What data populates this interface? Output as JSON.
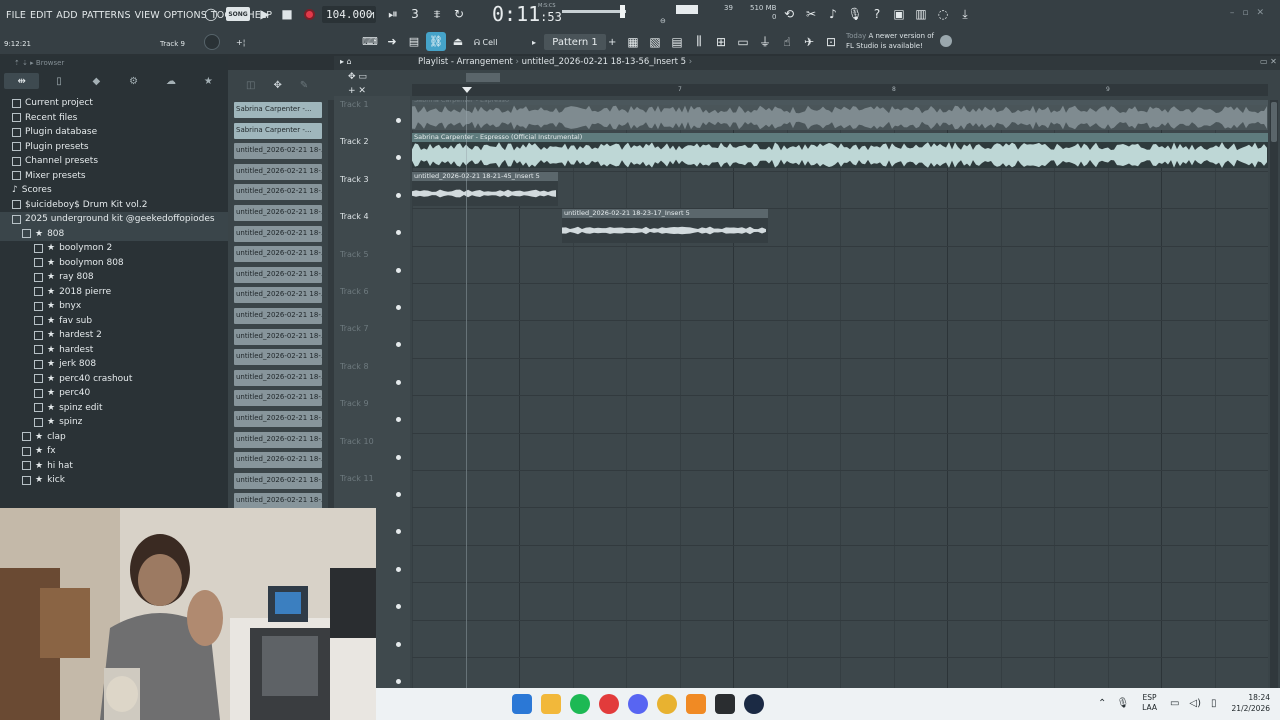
{
  "menu": [
    "FILE",
    "EDIT",
    "ADD",
    "PATTERNS",
    "VIEW",
    "OPTIONS",
    "TOOLS",
    "HELP"
  ],
  "transport": {
    "mode_label": "SONG",
    "tempo": "104.000",
    "time_main": "0:11",
    "time_sub": ":53",
    "time_unit": "M:S:CS",
    "volume_level": "39",
    "memory": "510 MB",
    "voices": "0"
  },
  "toolbar2": {
    "cursor_time": "9:12:21",
    "track_hint": "Track 9",
    "snap_mode": "Cell",
    "pattern": "Pattern 1",
    "news_date": "Today",
    "news_text_1": "A newer version of",
    "news_text_2": "FL Studio is available!"
  },
  "browser": {
    "header": "Browser",
    "items": [
      {
        "label": "Current project",
        "level": 0,
        "kind": "folder"
      },
      {
        "label": "Recent files",
        "level": 0,
        "kind": "folder"
      },
      {
        "label": "Plugin database",
        "level": 0,
        "kind": "folder"
      },
      {
        "label": "Plugin presets",
        "level": 0,
        "kind": "folder"
      },
      {
        "label": "Channel presets",
        "level": 0,
        "kind": "folder"
      },
      {
        "label": "Mixer presets",
        "level": 0,
        "kind": "folder"
      },
      {
        "label": "Scores",
        "level": 0,
        "kind": "note"
      },
      {
        "label": "$uicideboy$ Drum Kit vol.2",
        "level": 0,
        "kind": "folder"
      },
      {
        "label": "2025 underground kit @geekedoffopiodes",
        "level": 0,
        "kind": "folder-open"
      },
      {
        "label": "808",
        "level": 1,
        "kind": "star-folder"
      },
      {
        "label": "boolymon 2",
        "level": 2,
        "kind": "star-file"
      },
      {
        "label": "boolymon 808",
        "level": 2,
        "kind": "star-file"
      },
      {
        "label": "ray 808",
        "level": 2,
        "kind": "star-file"
      },
      {
        "label": "2018 pierre",
        "level": 2,
        "kind": "star-file"
      },
      {
        "label": "bnyx",
        "level": 2,
        "kind": "star-file"
      },
      {
        "label": "fav sub",
        "level": 2,
        "kind": "star-file"
      },
      {
        "label": "hardest 2",
        "level": 2,
        "kind": "star-file"
      },
      {
        "label": "hardest",
        "level": 2,
        "kind": "star-file"
      },
      {
        "label": "jerk 808",
        "level": 2,
        "kind": "star-file"
      },
      {
        "label": "perc40 crashout",
        "level": 2,
        "kind": "star-file"
      },
      {
        "label": "perc40",
        "level": 2,
        "kind": "star-file"
      },
      {
        "label": "spinz edit",
        "level": 2,
        "kind": "star-file"
      },
      {
        "label": "spinz",
        "level": 2,
        "kind": "star-file"
      },
      {
        "label": "clap",
        "level": 1,
        "kind": "star-folder"
      },
      {
        "label": "fx",
        "level": 1,
        "kind": "star-folder"
      },
      {
        "label": "hi hat",
        "level": 1,
        "kind": "star-folder"
      },
      {
        "label": "kick",
        "level": 1,
        "kind": "star-folder"
      }
    ]
  },
  "channels": [
    {
      "label": "Sabrina Carpenter -...",
      "audio": true
    },
    {
      "label": "Sabrina Carpenter -...",
      "audio": true
    },
    {
      "label": "untitled_2026-02-21 18-...",
      "audio": false
    },
    {
      "label": "untitled_2026-02-21 18-...",
      "audio": false
    },
    {
      "label": "untitled_2026-02-21 18-...",
      "audio": false
    },
    {
      "label": "untitled_2026-02-21 18-...",
      "audio": false
    },
    {
      "label": "untitled_2026-02-21 18-...",
      "audio": false
    },
    {
      "label": "untitled_2026-02-21 18-...",
      "audio": false
    },
    {
      "label": "untitled_2026-02-21 18-...",
      "audio": false
    },
    {
      "label": "untitled_2026-02-21 18-...",
      "audio": false
    },
    {
      "label": "untitled_2026-02-21 18-...",
      "audio": false
    },
    {
      "label": "untitled_2026-02-21 18-...",
      "audio": false
    },
    {
      "label": "untitled_2026-02-21 18-...",
      "audio": false
    },
    {
      "label": "untitled_2026-02-21 18-...",
      "audio": false
    },
    {
      "label": "untitled_2026-02-21 18-...",
      "audio": false
    },
    {
      "label": "untitled_2026-02-21 18-...",
      "audio": false
    },
    {
      "label": "untitled_2026-02-21 18-...",
      "audio": false
    },
    {
      "label": "untitled_2026-02-21 18-...",
      "audio": false
    },
    {
      "label": "untitled_2026-02-21 18-...",
      "audio": false
    },
    {
      "label": "untitled_2026-02-21 18-...",
      "audio": false
    }
  ],
  "playlist": {
    "title": "Playlist - Arrangement",
    "arrangement": "untitled_2026-02-21 18-13-56_Insert 5",
    "bar_numbers": [
      "7",
      "8",
      "9"
    ],
    "tracks": [
      {
        "label": "Track 1",
        "active": false
      },
      {
        "label": "Track 2",
        "active": true
      },
      {
        "label": "Track 3",
        "active": true
      },
      {
        "label": "Track 4",
        "active": true
      },
      {
        "label": "Track 5",
        "active": false
      },
      {
        "label": "Track 6",
        "active": false
      },
      {
        "label": "Track 7",
        "active": false
      },
      {
        "label": "Track 8",
        "active": false
      },
      {
        "label": "Track 9",
        "active": false
      },
      {
        "label": "Track 10",
        "active": false
      },
      {
        "label": "Track 11",
        "active": false
      }
    ],
    "clips": [
      {
        "track": 1,
        "title": "Sabrina Carpenter - Espresso"
      },
      {
        "track": 2,
        "title": "Sabrina Carpenter - Espresso (Official Instrumental)"
      },
      {
        "track": 3,
        "title": "untitled_2026-02-21 18-21-45_Insert 5"
      },
      {
        "track": 4,
        "title": "untitled_2026-02-21 18-23-17_Insert 5"
      }
    ]
  },
  "taskbar": {
    "lang_1": "ESP",
    "lang_2": "LAA",
    "time": "18:24",
    "date": "21/2/2026"
  }
}
